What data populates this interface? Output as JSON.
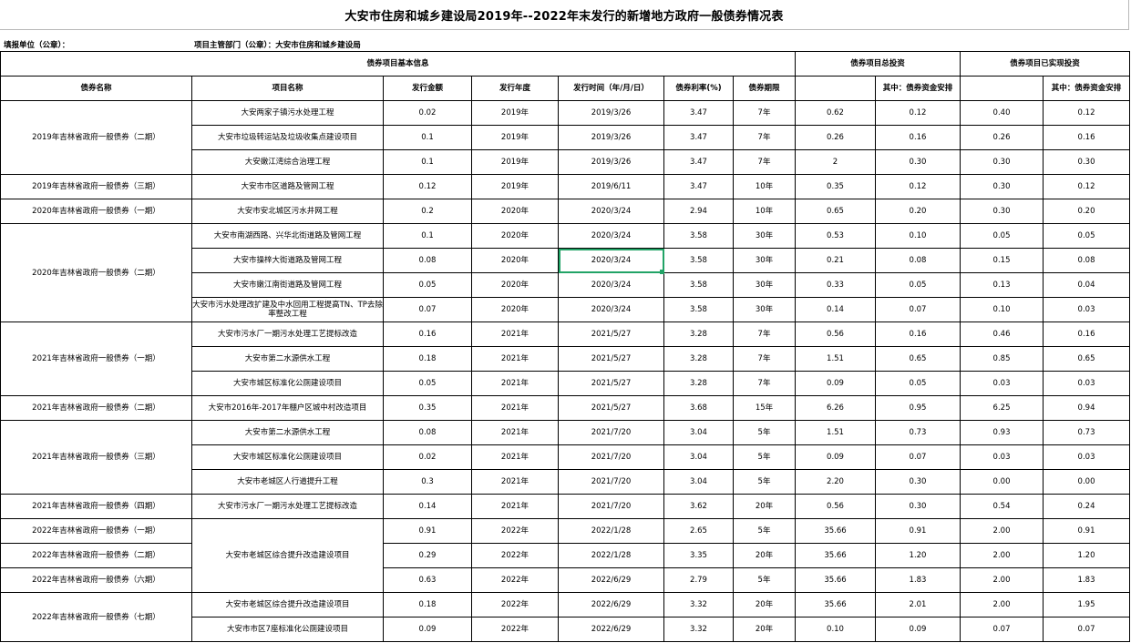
{
  "title": "大安市住房和城乡建设局2019年--2022年末发行的新增地方政府一般债券情况表",
  "meta": {
    "fill_unit": "填报单位（公章）：",
    "dept": "项目主管部门（公章）：大安市住房和城乡建设局"
  },
  "groups": {
    "basic": "债券项目基本信息",
    "total": "债券项目总投资",
    "realized": "债券项目已实现投资"
  },
  "headers": {
    "bond_name": "债券名称",
    "project_name": "项目名称",
    "amount": "发行金额",
    "year": "发行年度",
    "date": "发行时间（年/月/日）",
    "rate": "债券利率(%)",
    "term": "债券期限",
    "total_blank": "",
    "total_bond": "其中：债券资金安排",
    "real_blank": "",
    "real_bond": "其中：债券资金安排"
  },
  "rows": [
    {
      "bond": "2019年吉林省政府一般债券（二期）",
      "project": "大安两家子镇污水处理工程",
      "amount": "0.02",
      "year": "2019年",
      "date": "2019/3/26",
      "rate": "3.47",
      "term": "7年",
      "total": "0.62",
      "total_bond": "0.12",
      "real": "0.40",
      "real_bond": "0.12"
    },
    {
      "project": "大安市垃圾转运站及垃圾收集点建设项目",
      "amount": "0.1",
      "year": "2019年",
      "date": "2019/3/26",
      "rate": "3.47",
      "term": "7年",
      "total": "0.26",
      "total_bond": "0.16",
      "real": "0.26",
      "real_bond": "0.16"
    },
    {
      "project": "大安嫩江湾综合治理工程",
      "amount": "0.1",
      "year": "2019年",
      "date": "2019/3/26",
      "rate": "3.47",
      "term": "7年",
      "total": "2",
      "total_bond": "0.30",
      "real": "0.30",
      "real_bond": "0.30"
    },
    {
      "bond": "2019年吉林省政府一般债券（三期）",
      "project": "大安市市区道路及管网工程",
      "amount": "0.12",
      "year": "2019年",
      "date": "2019/6/11",
      "rate": "3.47",
      "term": "10年",
      "total": "0.35",
      "total_bond": "0.12",
      "real": "0.30",
      "real_bond": "0.12"
    },
    {
      "bond": "2020年吉林省政府一般债券（一期）",
      "project": "大安市安北城区污水井网工程",
      "amount": "0.2",
      "year": "2020年",
      "date": "2020/3/24",
      "rate": "2.94",
      "term": "10年",
      "total": "0.65",
      "total_bond": "0.20",
      "real": "0.30",
      "real_bond": "0.20"
    },
    {
      "bond": "2020年吉林省政府一般债券（二期）",
      "project": "大安市南湖西路、兴华北街道路及管网工程",
      "amount": "0.1",
      "year": "2020年",
      "date": "2020/3/24",
      "rate": "3.58",
      "term": "30年",
      "total": "0.53",
      "total_bond": "0.10",
      "real": "0.05",
      "real_bond": "0.05"
    },
    {
      "project": "大安市操梓大街道路及管网工程",
      "amount": "0.08",
      "year": "2020年",
      "date": "2020/3/24",
      "rate": "3.58",
      "term": "30年",
      "total": "0.21",
      "total_bond": "0.08",
      "real": "0.15",
      "real_bond": "0.08"
    },
    {
      "project": "大安市嫩江南街道路及管网工程",
      "amount": "0.05",
      "year": "2020年",
      "date": "2020/3/24",
      "rate": "3.58",
      "term": "30年",
      "total": "0.33",
      "total_bond": "0.05",
      "real": "0.13",
      "real_bond": "0.04"
    },
    {
      "project": "大安市污水处理改扩建及中水回用工程提高TN、TP去除率整改工程",
      "amount": "0.07",
      "year": "2020年",
      "date": "2020/3/24",
      "rate": "3.58",
      "term": "30年",
      "total": "0.14",
      "total_bond": "0.07",
      "real": "0.10",
      "real_bond": "0.03"
    },
    {
      "bond": "2021年吉林省政府一般债券（一期）",
      "project": "大安市污水厂一期污水处理工艺提标改造",
      "amount": "0.16",
      "year": "2021年",
      "date": "2021/5/27",
      "rate": "3.28",
      "term": "7年",
      "total": "0.56",
      "total_bond": "0.16",
      "real": "0.46",
      "real_bond": "0.16"
    },
    {
      "project": "大安市第二水源供水工程",
      "amount": "0.18",
      "year": "2021年",
      "date": "2021/5/27",
      "rate": "3.28",
      "term": "7年",
      "total": "1.51",
      "total_bond": "0.65",
      "real": "0.85",
      "real_bond": "0.65"
    },
    {
      "project": "大安市城区标准化公厕建设项目",
      "amount": "0.05",
      "year": "2021年",
      "date": "2021/5/27",
      "rate": "3.28",
      "term": "7年",
      "total": "0.09",
      "total_bond": "0.05",
      "real": "0.03",
      "real_bond": "0.03"
    },
    {
      "bond": "2021年吉林省政府一般债券（二期）",
      "project": "大安市2016年-2017年棚户区城中村改造项目",
      "amount": "0.35",
      "year": "2021年",
      "date": "2021/5/27",
      "rate": "3.68",
      "term": "15年",
      "total": "6.26",
      "total_bond": "0.95",
      "real": "6.25",
      "real_bond": "0.94"
    },
    {
      "bond": "2021年吉林省政府一般债券（三期）",
      "project": "大安市第二水源供水工程",
      "amount": "0.08",
      "year": "2021年",
      "date": "2021/7/20",
      "rate": "3.04",
      "term": "5年",
      "total": "1.51",
      "total_bond": "0.73",
      "real": "0.93",
      "real_bond": "0.73"
    },
    {
      "project": "大安市城区标准化公厕建设项目",
      "amount": "0.02",
      "year": "2021年",
      "date": "2021/7/20",
      "rate": "3.04",
      "term": "5年",
      "total": "0.09",
      "total_bond": "0.07",
      "real": "0.03",
      "real_bond": "0.03"
    },
    {
      "project": "大安市老城区人行道提升工程",
      "amount": "0.3",
      "year": "2021年",
      "date": "2021/7/20",
      "rate": "3.04",
      "term": "5年",
      "total": "2.20",
      "total_bond": "0.30",
      "real": "0.00",
      "real_bond": "0.00"
    },
    {
      "bond": "2021年吉林省政府一般债券（四期）",
      "project": "大安市污水厂一期污水处理工艺提标改造",
      "amount": "0.14",
      "year": "2021年",
      "date": "2021/7/20",
      "rate": "3.62",
      "term": "20年",
      "total": "0.56",
      "total_bond": "0.30",
      "real": "0.54",
      "real_bond": "0.24"
    },
    {
      "bond": "2022年吉林省政府一般债券（一期）",
      "project": "大安市老城区综合提升改造建设项目",
      "amount": "0.91",
      "year": "2022年",
      "date": "2022/1/28",
      "rate": "2.65",
      "term": "5年",
      "total": "35.66",
      "total_bond": "0.91",
      "real": "2.00",
      "real_bond": "0.91"
    },
    {
      "bond": "2022年吉林省政府一般债券（二期）",
      "amount": "0.29",
      "year": "2022年",
      "date": "2022/1/28",
      "rate": "3.35",
      "term": "20年",
      "total": "35.66",
      "total_bond": "1.20",
      "real": "2.00",
      "real_bond": "1.20"
    },
    {
      "bond": "2022年吉林省政府一般债券（六期）",
      "amount": "0.63",
      "year": "2022年",
      "date": "2022/6/29",
      "rate": "2.79",
      "term": "5年",
      "total": "35.66",
      "total_bond": "1.83",
      "real": "2.00",
      "real_bond": "1.83"
    },
    {
      "bond": "2022年吉林省政府一般债券（七期）",
      "project": "大安市老城区综合提升改造建设项目",
      "amount": "0.18",
      "year": "2022年",
      "date": "2022/6/29",
      "rate": "3.32",
      "term": "20年",
      "total": "35.66",
      "total_bond": "2.01",
      "real": "2.00",
      "real_bond": "1.95"
    },
    {
      "project": "大安市市区7座标准化公厕建设项目",
      "amount": "0.09",
      "year": "2022年",
      "date": "2022/6/29",
      "rate": "3.32",
      "term": "20年",
      "total": "0.10",
      "total_bond": "0.09",
      "real": "0.07",
      "real_bond": "0.07"
    }
  ]
}
